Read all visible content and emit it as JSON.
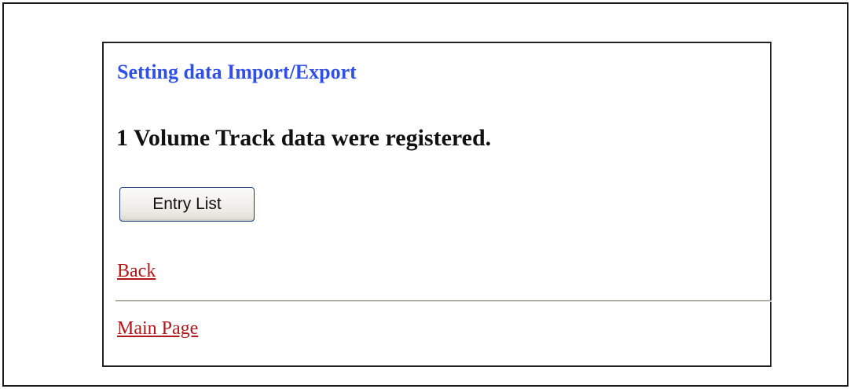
{
  "page": {
    "title": "Setting data Import/Export",
    "message": "1 Volume Track data were registered."
  },
  "actions": {
    "entry_list_label": "Entry List"
  },
  "links": {
    "back_label": "Back",
    "main_page_label": "Main Page"
  },
  "colors": {
    "title": "#2f4fe6",
    "link": "#b0171a",
    "message": "#111111"
  }
}
